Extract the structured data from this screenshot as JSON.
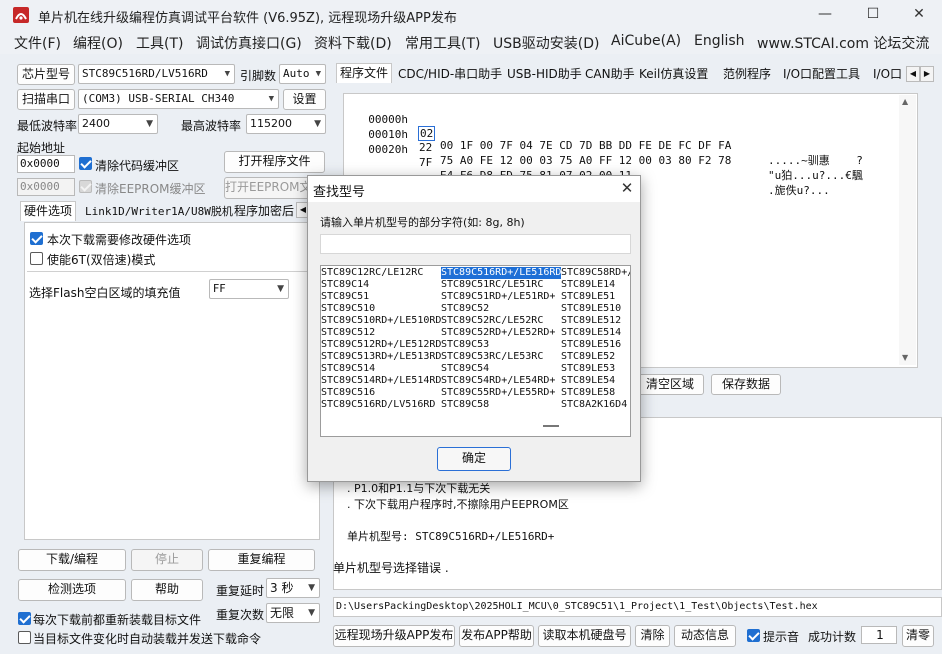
{
  "window": {
    "title": "单片机在线升级编程仿真调试平台软件 (V6.95Z), 远程现场升级APP发布",
    "minimize": "—",
    "maximize": "☐",
    "close": "✕"
  },
  "menu": [
    "文件(F)",
    "编程(O)",
    "工具(T)",
    "调试仿真接口(G)",
    "资料下载(D)",
    "常用工具(T)",
    "USB驱动安装(D)",
    "AiCube(A)",
    "English",
    "www.STCAI.com 论坛交流"
  ],
  "left": {
    "chip_model_btn": "芯片型号",
    "chip_model_value": "STC89C516RD/LV516RD",
    "pin_label": "引脚数",
    "pin_value": "Auto",
    "scan_btn": "扫描串口",
    "port_value": "(COM3) USB-SERIAL CH340",
    "settings_btn": "设置",
    "min_baud_label": "最低波特率",
    "min_baud_value": "2400",
    "max_baud_label": "最高波特率",
    "max_baud_value": "115200",
    "start_addr_label": "起始地址",
    "code_addr": "0x0000",
    "clear_code_label": "清除代码缓冲区",
    "open_prog_btn": "打开程序文件",
    "eeprom_addr": "0x0000",
    "clear_eeprom_label": "清除EEPROM缓冲区",
    "open_eeprom_btn": "打开EEPROM文件",
    "tabs": [
      "硬件选项",
      "Link1D/Writer1A/U8W脱机",
      "程序加密后"
    ],
    "opt_modify_hw": "本次下载需要修改硬件选项",
    "opt_6t": "使能6T(双倍速)模式",
    "flash_fill_label": "选择Flash空白区域的填充值",
    "flash_fill_value": "FF",
    "download_btn": "下载/编程",
    "stop_btn": "停止",
    "reprogram_btn": "重复编程",
    "detect_btn": "检测选项",
    "help_btn": "帮助",
    "repeat_delay_label": "重复延时",
    "repeat_delay_value": "3 秒",
    "repeat_count_label": "重复次数",
    "repeat_count_value": "无限",
    "reload_label": "每次下载前都重新装载目标文件",
    "auto_send_label": "当目标文件变化时自动装载并发送下载命令"
  },
  "right": {
    "tabs": [
      "程序文件",
      "CDC/HID-串口助手",
      "USB-HID助手",
      "CAN助手",
      "Keil仿真设置",
      "范例程序",
      "I/O口配置工具",
      "I/O口"
    ],
    "hex_rows": [
      {
        "addr": "00000h",
        "first": "02",
        "bytes": "00 1F 00 7F 04 7E CD 7D BB DD FE DE FC DF FA",
        "ascii": ".....~驯惠    ?"
      },
      {
        "addr": "00010h",
        "first": "22",
        "bytes": "75 A0 FE 12 00 03 75 A0 FF 12 00 03 80 F2 78",
        "ascii": "\"u狛...u?...€颿"
      },
      {
        "addr": "00020h",
        "first": "7F",
        "bytes": "E4 F6 D8 FD 75 81 07 02 00 11",
        "ascii": ".旎佚u?..."
      }
    ],
    "clear_area_btn": "清空区域",
    "save_data_btn": "保存数据",
    "log_lines": [
      ". P1.0和P1.1与下次下载无关",
      ". 下次下载用户程序时,不擦除用户EEPROM区"
    ],
    "chip_line": "单片机型号: STC89C516RD+/LE516RD+",
    "error_line": "单片机型号选择错误 .",
    "path": "D:\\UsersPackingDesktop\\2025HOLI_MCU\\0_STC89C51\\1_Project\\1_Test\\Objects\\Test.hex",
    "publish_btn": "远程现场升级APP发布",
    "publish_help_btn": "发布APP帮助",
    "read_disk_btn": "读取本机硬盘号",
    "clear_btn": "清除",
    "dyn_info_btn": "动态信息",
    "beep_label": "提示音",
    "success_label": "成功计数",
    "success_value": "1",
    "clear2_btn": "清零"
  },
  "dialog": {
    "title": "查找型号",
    "prompt": "请输入单片机型号的部分字符(如: 8g, 8h)",
    "input_value": "",
    "selected": "STC89C516RD+/LE516RD",
    "columns": [
      [
        "STC89C12RC/LE12RC",
        "STC89C14",
        "STC89C51",
        "STC89C510",
        "STC89C510RD+/LE510RD",
        "STC89C512",
        "STC89C512RD+/LE512RD",
        "STC89C513RD+/LE513RD",
        "STC89C514",
        "STC89C514RD+/LE514RD",
        "STC89C516",
        "STC89C516RD/LV516RD"
      ],
      [
        "STC89C516RD+/LE516RD",
        "STC89C51RC/LE51RC",
        "STC89C51RD+/LE51RD+",
        "STC89C52",
        "STC89C52RC/LE52RC",
        "STC89C52RD+/LE52RD+",
        "STC89C53",
        "STC89C53RC/LE53RC",
        "STC89C54",
        "STC89C54RD+/LE54RD+",
        "STC89C55RD+/LE55RD+",
        "STC89C58"
      ],
      [
        "STC89C58RD+/",
        "STC89LE14",
        "STC89LE51",
        "STC89LE510",
        "STC89LE512",
        "STC89LE514",
        "STC89LE516",
        "STC89LE52",
        "STC89LE53",
        "STC89LE54",
        "STC89LE58",
        "STC8A2K16D4"
      ]
    ],
    "ok_btn": "确定"
  }
}
